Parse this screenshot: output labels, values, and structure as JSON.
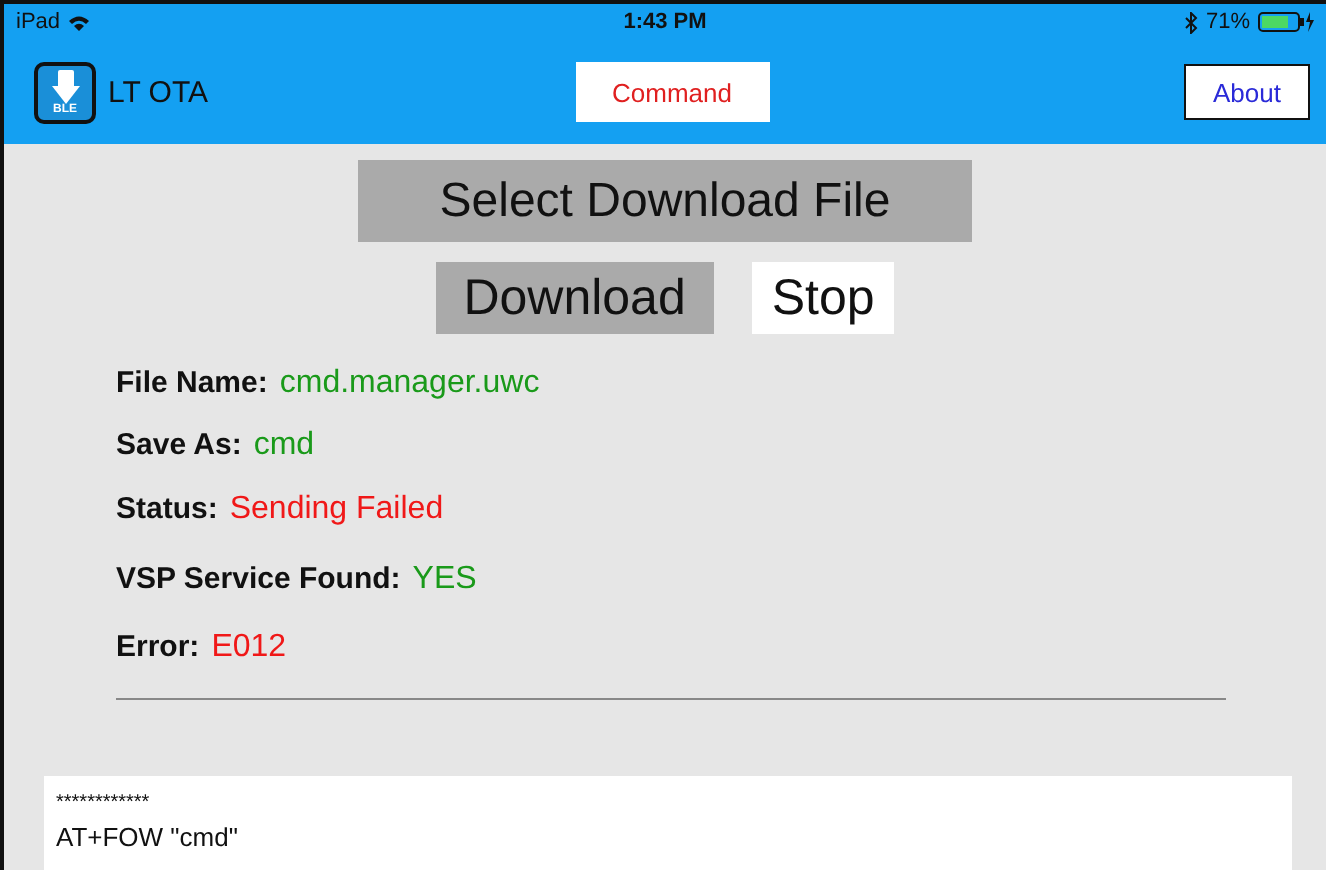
{
  "status_bar": {
    "carrier": "iPad",
    "time": "1:43 PM",
    "battery": "71%"
  },
  "nav_bar": {
    "title": "LT OTA",
    "app_icon_label": "BLE",
    "center_button": "Command",
    "right_button": "About"
  },
  "select_button": "Select Download File",
  "action_buttons": [
    {
      "label": "Download",
      "active": true
    },
    {
      "label": "Stop",
      "active": false
    }
  ],
  "fields": [
    {
      "label": "File Name:",
      "value": "cmd.manager.uwc",
      "color": "#1a9a1a"
    },
    {
      "label": "Save As:",
      "value": "cmd",
      "color": "#1a9a1a"
    },
    {
      "label": "Status:",
      "value": "Sending Failed",
      "color": "#f01818"
    },
    {
      "label": "VSP Service Found:",
      "value": "YES",
      "color": "#1a9a1a"
    },
    {
      "label": "Error:",
      "value": "E012",
      "color": "#f01818"
    }
  ],
  "log": [
    {
      "text": "************",
      "kind": "small"
    },
    {
      "text": "AT+FOW \"cmd\"",
      "kind": "normal"
    }
  ]
}
